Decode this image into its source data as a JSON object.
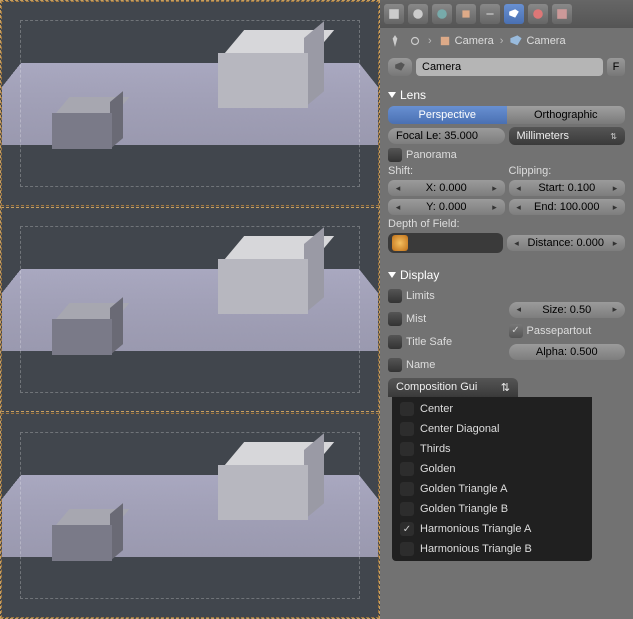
{
  "breadcrumbs": {
    "obj": "Camera",
    "data": "Camera"
  },
  "namebox": {
    "value": "Camera",
    "fake": "F"
  },
  "lens": {
    "title": "Lens",
    "perspective": "Perspective",
    "orthographic": "Orthographic",
    "focal": "Focal Le: 35.000",
    "units": "Millimeters",
    "panorama": "Panorama",
    "shift_label": "Shift:",
    "shift_x": "X: 0.000",
    "shift_y": "Y: 0.000",
    "clip_label": "Clipping:",
    "clip_start": "Start: 0.100",
    "clip_end": "End: 100.000",
    "dof_label": "Depth of Field:",
    "dof_dist": "Distance: 0.000"
  },
  "display": {
    "title": "Display",
    "limits": "Limits",
    "mist": "Mist",
    "titlesafe": "Title Safe",
    "name": "Name",
    "size": "Size: 0.50",
    "passepartout": "Passepartout",
    "alpha": "Alpha: 0.500",
    "comp": "Composition Gui"
  },
  "menu": {
    "items": [
      {
        "label": "Center",
        "checked": false
      },
      {
        "label": "Center Diagonal",
        "checked": false
      },
      {
        "label": "Thirds",
        "checked": false
      },
      {
        "label": "Golden",
        "checked": false
      },
      {
        "label": "Golden Triangle A",
        "checked": false
      },
      {
        "label": "Golden Triangle B",
        "checked": false
      },
      {
        "label": "Harmonious Triangle A",
        "checked": true
      },
      {
        "label": "Harmonious Triangle B",
        "checked": false
      }
    ]
  }
}
